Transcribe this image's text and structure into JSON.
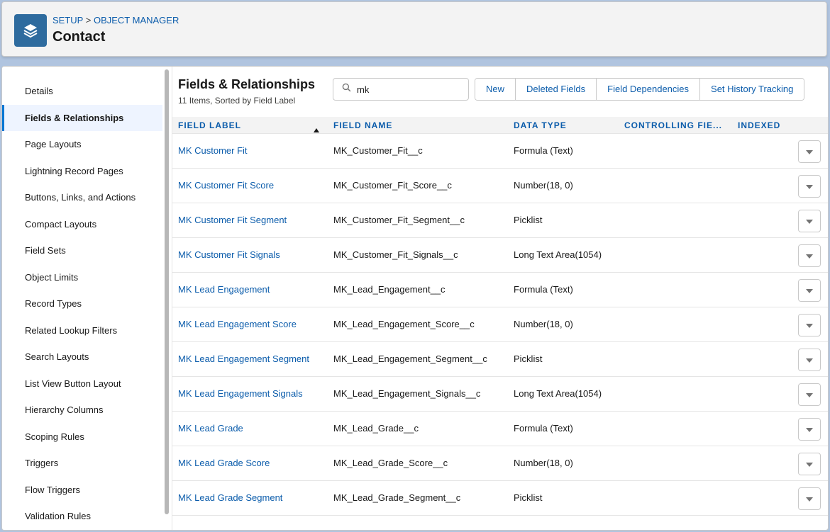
{
  "header": {
    "breadcrumb": [
      "SETUP",
      "OBJECT MANAGER"
    ],
    "breadcrumb_separator": ">",
    "title": "Contact",
    "icon": "layers-icon",
    "icon_color": "#2e6b9e"
  },
  "sidebar": {
    "items": [
      {
        "label": "Details",
        "active": false
      },
      {
        "label": "Fields & Relationships",
        "active": true
      },
      {
        "label": "Page Layouts",
        "active": false
      },
      {
        "label": "Lightning Record Pages",
        "active": false
      },
      {
        "label": "Buttons, Links, and Actions",
        "active": false
      },
      {
        "label": "Compact Layouts",
        "active": false
      },
      {
        "label": "Field Sets",
        "active": false
      },
      {
        "label": "Object Limits",
        "active": false
      },
      {
        "label": "Record Types",
        "active": false
      },
      {
        "label": "Related Lookup Filters",
        "active": false
      },
      {
        "label": "Search Layouts",
        "active": false
      },
      {
        "label": "List View Button Layout",
        "active": false
      },
      {
        "label": "Hierarchy Columns",
        "active": false
      },
      {
        "label": "Scoping Rules",
        "active": false
      },
      {
        "label": "Triggers",
        "active": false
      },
      {
        "label": "Flow Triggers",
        "active": false
      },
      {
        "label": "Validation Rules",
        "active": false
      }
    ]
  },
  "main": {
    "title": "Fields & Relationships",
    "subtitle": "11 Items, Sorted by Field Label",
    "search": {
      "value": "mk",
      "placeholder": "",
      "icon": "search-icon"
    },
    "buttons": [
      "New",
      "Deleted Fields",
      "Field Dependencies",
      "Set History Tracking"
    ],
    "columns": [
      "FIELD LABEL",
      "FIELD NAME",
      "DATA TYPE",
      "CONTROLLING FIE...",
      "INDEXED"
    ],
    "sort_icon": "sort-ascending-icon",
    "rows": [
      {
        "label": "MK Customer Fit",
        "name": "MK_Customer_Fit__c",
        "type": "Formula (Text)"
      },
      {
        "label": "MK Customer Fit Score",
        "name": "MK_Customer_Fit_Score__c",
        "type": "Number(18, 0)"
      },
      {
        "label": "MK Customer Fit Segment",
        "name": "MK_Customer_Fit_Segment__c",
        "type": "Picklist"
      },
      {
        "label": "MK Customer Fit Signals",
        "name": "MK_Customer_Fit_Signals__c",
        "type": "Long Text Area(1054)"
      },
      {
        "label": "MK Lead Engagement",
        "name": "MK_Lead_Engagement__c",
        "type": "Formula (Text)"
      },
      {
        "label": "MK Lead Engagement Score",
        "name": "MK_Lead_Engagement_Score__c",
        "type": "Number(18, 0)"
      },
      {
        "label": "MK Lead Engagement Segment",
        "name": "MK_Lead_Engagement_Segment__c",
        "type": "Picklist"
      },
      {
        "label": "MK Lead Engagement Signals",
        "name": "MK_Lead_Engagement_Signals__c",
        "type": "Long Text Area(1054)"
      },
      {
        "label": "MK Lead Grade",
        "name": "MK_Lead_Grade__c",
        "type": "Formula (Text)"
      },
      {
        "label": "MK Lead Grade Score",
        "name": "MK_Lead_Grade_Score__c",
        "type": "Number(18, 0)"
      },
      {
        "label": "MK Lead Grade Segment",
        "name": "MK_Lead_Grade_Segment__c",
        "type": "Picklist"
      }
    ],
    "row_action_icon": "chevron-down-icon"
  },
  "colors": {
    "link": "#0b5cab",
    "active_nav_bg": "#eef4ff",
    "active_nav_border": "#0176d3",
    "page_bg": "#b0c4df"
  }
}
